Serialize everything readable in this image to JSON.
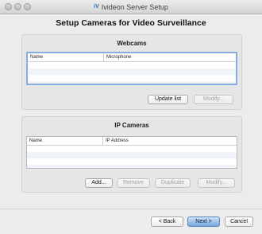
{
  "window": {
    "title": "Ivideon Server Setup",
    "app_icon_text": "iV"
  },
  "page": {
    "heading": "Setup Cameras for Video Surveillance"
  },
  "webcams": {
    "title": "Webcams",
    "columns": [
      "Name",
      "Microphone"
    ],
    "rows": [],
    "buttons": {
      "update_list": "Update list",
      "modify": "Modify..."
    }
  },
  "ip_cameras": {
    "title": "IP Cameras",
    "columns": [
      "Name",
      "IP Address"
    ],
    "rows": [],
    "buttons": {
      "add": "Add...",
      "remove": "Remove",
      "duplicate": "Duplicate",
      "modify": "Modify..."
    }
  },
  "footer": {
    "back": "< Back",
    "next": "Next >",
    "cancel": "Cancel"
  },
  "colors": {
    "default_button": "#74a6e2",
    "focus_ring": "#86aee0",
    "row_alt": "#f0f4fa"
  }
}
